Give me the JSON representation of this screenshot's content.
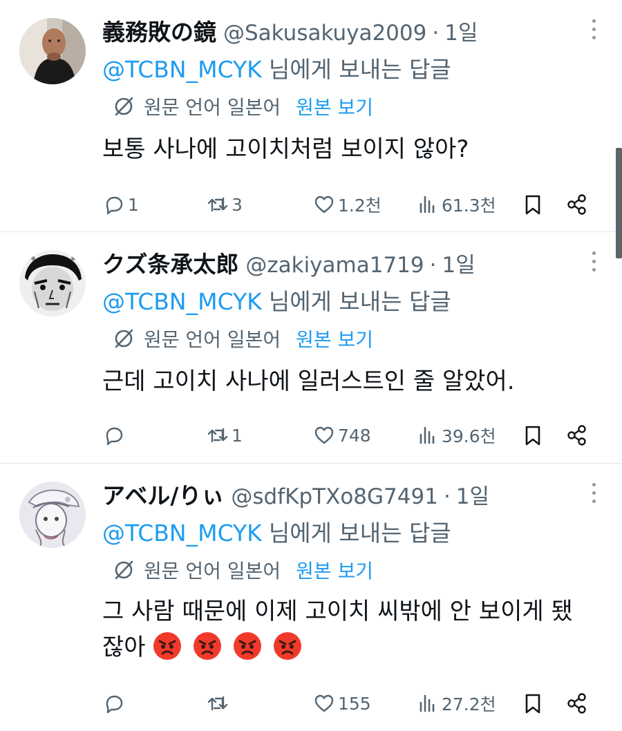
{
  "ui": {
    "translate_icon": "translate-off-icon",
    "colors": {
      "link": "#1d9bf0",
      "secondary": "#536471",
      "text": "#0f1419",
      "divider": "#e1e6ea"
    }
  },
  "tweets": [
    {
      "name": "義務敗の鏡",
      "handle": "@Sakusakuya2009",
      "separator": "·",
      "time": "1일",
      "reply_to": "@TCBN_MCYK",
      "reply_suffix": "님에게 보내는 답글",
      "translate_label": "원문 언어 일본어",
      "view_original": "원본 보기",
      "text": "보통 사나에 고이치처럼 보이지 않아?",
      "emojis": [],
      "replies": "1",
      "reposts": "3",
      "likes": "1.2천",
      "views": "61.3천",
      "avatar": "avatar-photo-man"
    },
    {
      "name": "クズ条承太郎",
      "handle": "@zakiyama1719",
      "separator": "·",
      "time": "1일",
      "reply_to": "@TCBN_MCYK",
      "reply_suffix": "님에게 보내는 답글",
      "translate_label": "원문 언어 일본어",
      "view_original": "원본 보기",
      "text": "근데 고이치 사나에 일러스트인 줄 알았어.",
      "emojis": [],
      "replies": "",
      "reposts": "1",
      "likes": "748",
      "views": "39.6천",
      "avatar": "avatar-manga-character"
    },
    {
      "name": "アベル/りぃ",
      "handle": "@sdfKpTXo8G7491",
      "separator": "·",
      "time": "1일",
      "reply_to": "@TCBN_MCYK",
      "reply_suffix": "님에게 보내는 답글",
      "translate_label": "원문 언어 일본어",
      "view_original": "원본 보기",
      "text": "그 사람 때문에 이제 고이치 씨밖에 안 보이게 됐잖아",
      "emojis": [
        "angry-face-emoji",
        "angry-face-emoji",
        "angry-face-emoji",
        "angry-face-emoji"
      ],
      "replies": "",
      "reposts": "",
      "likes": "155",
      "views": "27.2천",
      "avatar": "avatar-anime-sketch"
    }
  ]
}
